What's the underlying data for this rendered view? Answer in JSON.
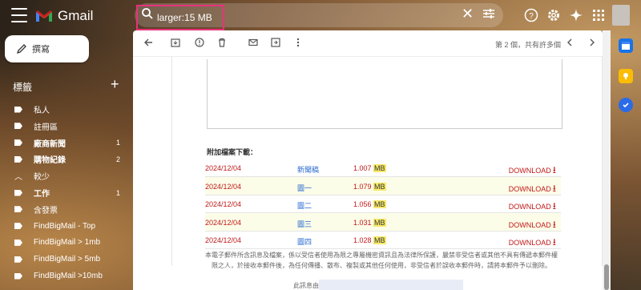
{
  "app": {
    "name": "Gmail"
  },
  "search": {
    "query": "larger:15 MB"
  },
  "compose": {
    "label": "撰寫"
  },
  "labels": {
    "heading": "標籤"
  },
  "nav": [
    {
      "label": "私人",
      "type": "label",
      "count": ""
    },
    {
      "label": "註冊區",
      "type": "label",
      "count": ""
    },
    {
      "label": "廠商新聞",
      "type": "label",
      "count": "1",
      "bold": true
    },
    {
      "label": "購物紀錄",
      "type": "label",
      "count": "2",
      "bold": true
    },
    {
      "label": "較少",
      "type": "less",
      "count": ""
    },
    {
      "label": "工作",
      "type": "label",
      "count": "1",
      "bold": true
    },
    {
      "label": "含發票",
      "type": "label",
      "count": ""
    },
    {
      "label": "FindBigMail - Top",
      "type": "label",
      "count": ""
    },
    {
      "label": "FindBigMail > 1mb",
      "type": "label",
      "count": ""
    },
    {
      "label": "FindBigMail > 5mb",
      "type": "label",
      "count": ""
    },
    {
      "label": "FindBigMail >10mb",
      "type": "label",
      "count": ""
    }
  ],
  "toolbar": {
    "pager": "第 2 個，共有許多個"
  },
  "email": {
    "attach_title": "附加檔案下載：",
    "attachments": [
      {
        "date": "2024/12/04",
        "name": "新聞稿",
        "size": "1.007",
        "unit": "MB",
        "action": "DOWNLOAD"
      },
      {
        "date": "2024/12/04",
        "name": "圖一",
        "size": "1.079",
        "unit": "MB",
        "action": "DOWNLOAD"
      },
      {
        "date": "2024/12/04",
        "name": "圖二",
        "size": "1.056",
        "unit": "MB",
        "action": "DOWNLOAD"
      },
      {
        "date": "2024/12/04",
        "name": "圖三",
        "size": "1.031",
        "unit": "MB",
        "action": "DOWNLOAD"
      },
      {
        "date": "2024/12/04",
        "name": "圖四",
        "size": "1.028",
        "unit": "MB",
        "action": "DOWNLOAD"
      }
    ],
    "footer": "本電子郵件所含訊息及檔案，係以受信者使用為限之專屬機密資訊且為法律所保護，嚴禁非受信者或其他不具有傳遞本郵件權限之人，於接收本郵件後，為任何傳播、散布、複製或其他任何使用，非受信者於誤收本郵件時，請將本郵件予以刪除。",
    "from_label": "此訊息由"
  }
}
